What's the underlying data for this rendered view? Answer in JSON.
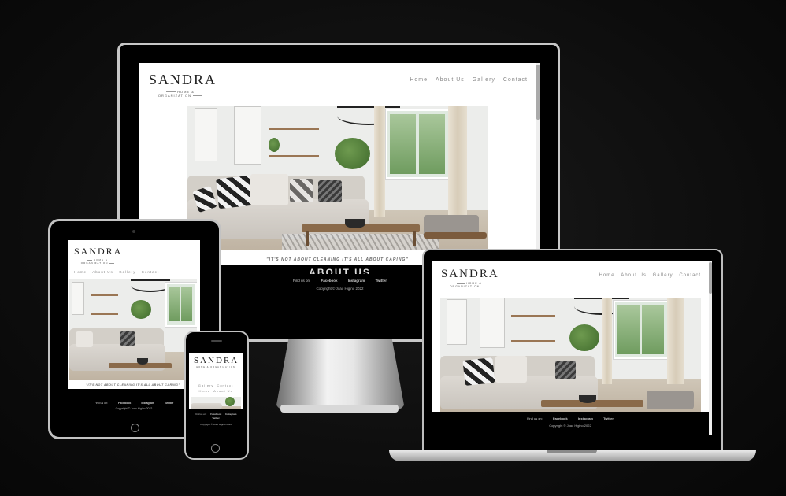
{
  "site": {
    "logo": "SANDRA",
    "tagline": "HOME & ORGANIZATION",
    "nav": [
      "Home",
      "About Us",
      "Gallery",
      "Contact"
    ],
    "quote": "\"IT'S NOT ABOUT CLEANING IT'S ALL ABOUT CARING\"",
    "section_heading": "ABOUT US",
    "find_us": "Find us on:",
    "social": [
      "Facebook",
      "Instagram",
      "Twitter"
    ],
    "copyright": "Copyright © Joao Higino 2022"
  },
  "colors": {
    "background": "#0c0c0c",
    "site_bg": "#ffffff",
    "footer_bg": "#000000",
    "nav_text": "#888888",
    "device_silver": "#c7c7c7"
  }
}
